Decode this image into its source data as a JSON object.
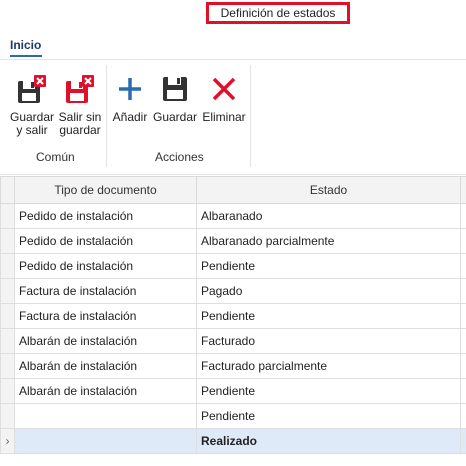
{
  "window": {
    "title": "Definición de estados"
  },
  "ribbon": {
    "tab": "Inicio",
    "groups": [
      {
        "label": "Común",
        "buttons": [
          {
            "label": "Guardar y salir",
            "icon": "save-close-icon"
          },
          {
            "label": "Salir sin guardar",
            "icon": "exit-no-save-icon"
          }
        ]
      },
      {
        "label": "Acciones",
        "buttons": [
          {
            "label": "Añadir",
            "icon": "add-icon"
          },
          {
            "label": "Guardar",
            "icon": "save-icon"
          },
          {
            "label": "Eliminar",
            "icon": "delete-icon"
          }
        ]
      }
    ]
  },
  "grid": {
    "columns": [
      "Tipo de documento",
      "Estado"
    ],
    "rows": [
      [
        "Pedido de instalación",
        "Albaranado"
      ],
      [
        "Pedido de instalación",
        "Albaranado parcialmente"
      ],
      [
        "Pedido de instalación",
        "Pendiente"
      ],
      [
        "Factura de instalación",
        "Pagado"
      ],
      [
        "Factura de instalación",
        "Pendiente"
      ],
      [
        "Albarán de instalación",
        "Facturado"
      ],
      [
        "Albarán de instalación",
        "Facturado parcialmente"
      ],
      [
        "Albarán de instalación",
        "Pendiente"
      ],
      [
        "",
        "Pendiente"
      ],
      [
        "",
        "Realizado"
      ]
    ],
    "row_indicator": "›"
  },
  "colors": {
    "accent": "#2b6cb0",
    "danger": "#e0102a",
    "selected_row": "#dfeaf8"
  }
}
